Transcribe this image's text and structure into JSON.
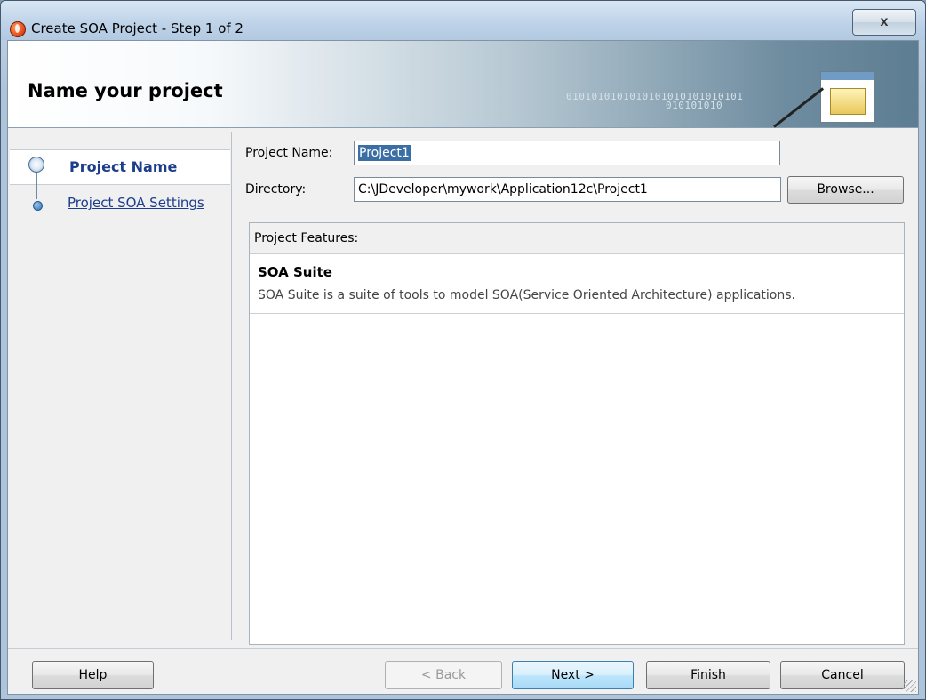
{
  "window": {
    "title": "Create SOA Project - Step 1 of 2",
    "close_glyph": "x"
  },
  "banner": {
    "title": "Name your project",
    "binary_1": "0101010101010101010101010101",
    "binary_2": "010101010"
  },
  "nav": {
    "steps": [
      {
        "label": "Project Name",
        "active": true
      },
      {
        "label": "Project SOA Settings",
        "active": false
      }
    ]
  },
  "form": {
    "project_name_label": "Project Name:",
    "project_name_value": "Project1",
    "directory_label": "Directory:",
    "directory_value": "C:\\JDeveloper\\mywork\\Application12c\\Project1",
    "browse_label": "Browse..."
  },
  "features": {
    "header": "Project Features:",
    "items": [
      {
        "name": "SOA Suite",
        "description": "SOA Suite is a suite of tools to model SOA(Service Oriented Architecture) applications."
      }
    ]
  },
  "buttons": {
    "help": "Help",
    "back": "< Back",
    "next": "Next >",
    "finish": "Finish",
    "cancel": "Cancel"
  },
  "colors": {
    "link": "#1c3d8c",
    "selection": "#3a6ea5"
  }
}
